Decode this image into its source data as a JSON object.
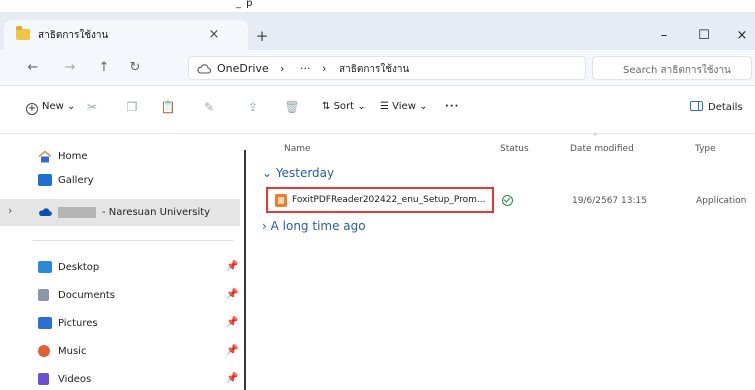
{
  "caption_fragment": "_ p",
  "window": {
    "tab_title": "สาธิตการใช้งาน",
    "tab_close": "×",
    "new_tab": "+",
    "minimize": "–",
    "maximize": "☐",
    "close": "×"
  },
  "address_bar": {
    "back": "←",
    "forward": "→",
    "up": "↑",
    "refresh": "↻",
    "crumbs": [
      "OneDrive",
      "›",
      "···",
      "›",
      "สาธิตการใช้งาน"
    ],
    "search_placeholder": "Search สาธิตการใช้งาน"
  },
  "command_bar": {
    "new_label": "New",
    "sort_label": "Sort",
    "view_label": "View",
    "more_label": "···",
    "details_label": "Details"
  },
  "sidebar": {
    "items": [
      {
        "label": "Home",
        "icon": "home-icon"
      },
      {
        "label": "Gallery",
        "icon": "gallery-icon"
      },
      {
        "label": "- Naresuan University",
        "icon": "onedrive-cloud-icon"
      },
      {
        "label": "Desktop",
        "icon": "desktop-icon"
      },
      {
        "label": "Documents",
        "icon": "documents-icon"
      },
      {
        "label": "Pictures",
        "icon": "pictures-icon"
      },
      {
        "label": "Music",
        "icon": "music-icon"
      },
      {
        "label": "Videos",
        "icon": "videos-icon"
      }
    ]
  },
  "file_list": {
    "columns": [
      "Name",
      "Status",
      "Date modified",
      "Type"
    ],
    "groups": [
      {
        "label": "Yesterday",
        "expanded": true
      },
      {
        "label": "A long time ago",
        "expanded": false
      }
    ],
    "rows": [
      {
        "name": "FoxitPDFReader202422_enu_Setup_Prom...",
        "status": "synced",
        "date": "19/6/2567 13:15",
        "type": "Application"
      }
    ]
  },
  "colors": {
    "accent": "#2a6fd1",
    "highlight_border": "#e53935",
    "group_text": "#2b5aa8"
  }
}
